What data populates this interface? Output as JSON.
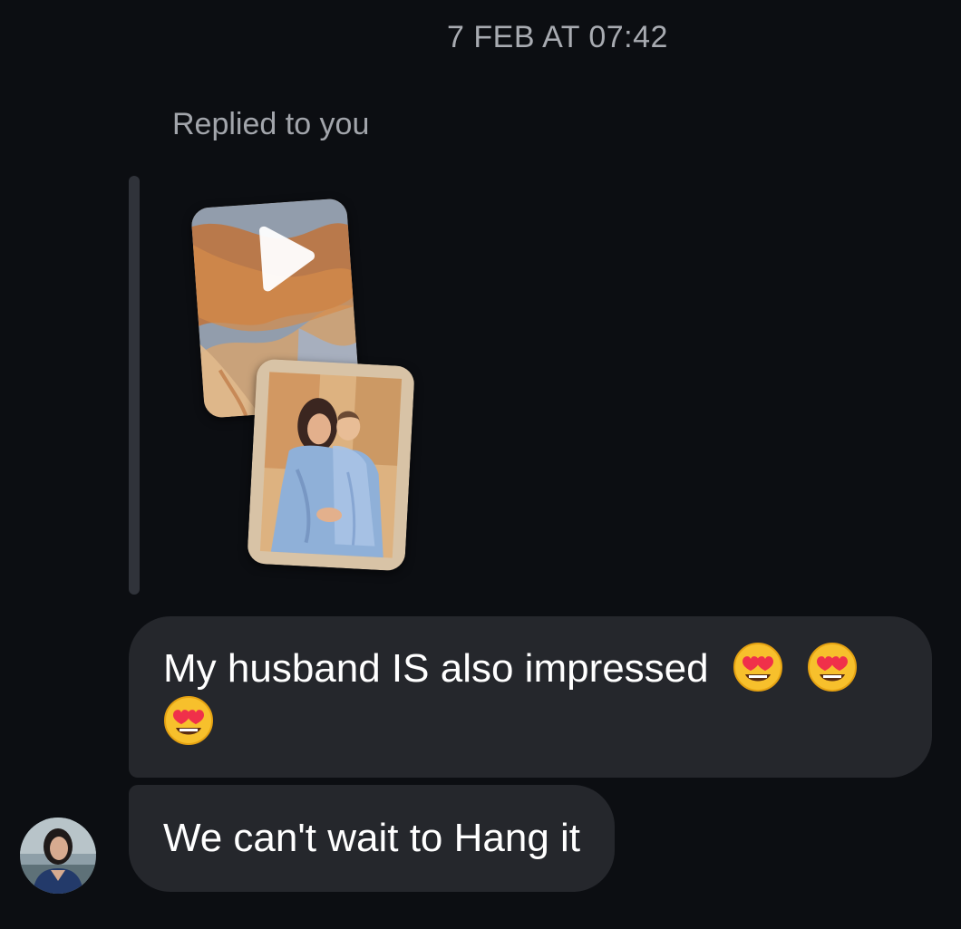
{
  "thread": {
    "timestamp": "7 FEB AT 07:42"
  },
  "reply": {
    "label": "Replied to you",
    "attachments": [
      {
        "kind": "video",
        "icon": "play-icon",
        "description_icon": "watercolor-video-thumbnail"
      },
      {
        "kind": "image",
        "icon": "watercolor-portrait-thumbnail"
      }
    ]
  },
  "messages": [
    {
      "text": "My husband IS also impressed",
      "emoji": [
        "smiling-face-with-heart-eyes",
        "smiling-face-with-heart-eyes",
        "smiling-face-with-heart-eyes"
      ]
    },
    {
      "text": "We can't wait to Hang it"
    }
  ],
  "sender": {
    "avatar_icon": "user-avatar"
  },
  "colors": {
    "background": "#0c0e12",
    "bubble": "#25272c",
    "reply_bar": "#30333a",
    "muted_text": "#a8abb1"
  }
}
